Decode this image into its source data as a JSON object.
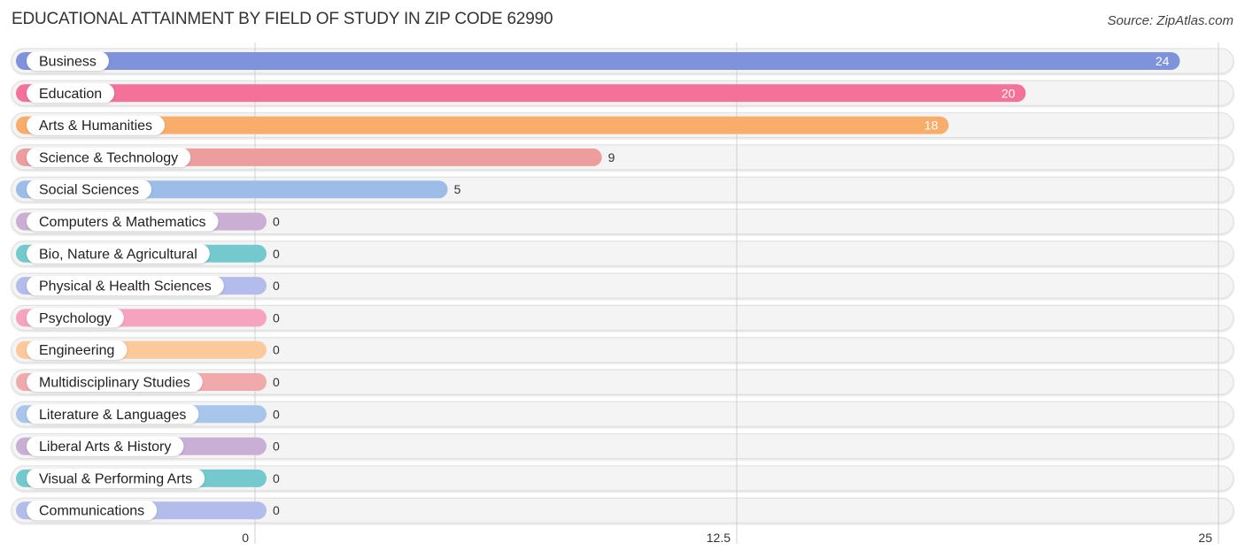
{
  "header": {
    "title": "EDUCATIONAL ATTAINMENT BY FIELD OF STUDY IN ZIP CODE 62990",
    "source": "Source: ZipAtlas.com"
  },
  "chart_data": {
    "type": "bar",
    "orientation": "horizontal",
    "title": "EDUCATIONAL ATTAINMENT BY FIELD OF STUDY IN ZIP CODE 62990",
    "xlabel": "",
    "ylabel": "",
    "xlim": [
      0,
      25
    ],
    "x_ticks": [
      0,
      12.5,
      25
    ],
    "x_tick_labels": [
      "0",
      "12.5",
      "25"
    ],
    "grid": true,
    "categories": [
      "Business",
      "Education",
      "Arts & Humanities",
      "Science & Technology",
      "Social Sciences",
      "Computers & Mathematics",
      "Bio, Nature & Agricultural",
      "Physical & Health Sciences",
      "Psychology",
      "Engineering",
      "Multidisciplinary Studies",
      "Literature & Languages",
      "Liberal Arts & History",
      "Visual & Performing Arts",
      "Communications"
    ],
    "values": [
      24,
      20,
      18,
      9,
      5,
      0,
      0,
      0,
      0,
      0,
      0,
      0,
      0,
      0,
      0
    ],
    "value_labels": [
      "24",
      "20",
      "18",
      "9",
      "5",
      "0",
      "0",
      "0",
      "0",
      "0",
      "0",
      "0",
      "0",
      "0",
      "0"
    ],
    "colors": [
      "#7f93dd",
      "#f4719a",
      "#f9ad6a",
      "#ec9d9d",
      "#9dbde8",
      "#cbaed4",
      "#74c9cf",
      "#b3bdec",
      "#f6a3c0",
      "#fbc99b",
      "#f0aaab",
      "#a8c6ec",
      "#c9aed5",
      "#74c9cf",
      "#b3bdec"
    ]
  }
}
